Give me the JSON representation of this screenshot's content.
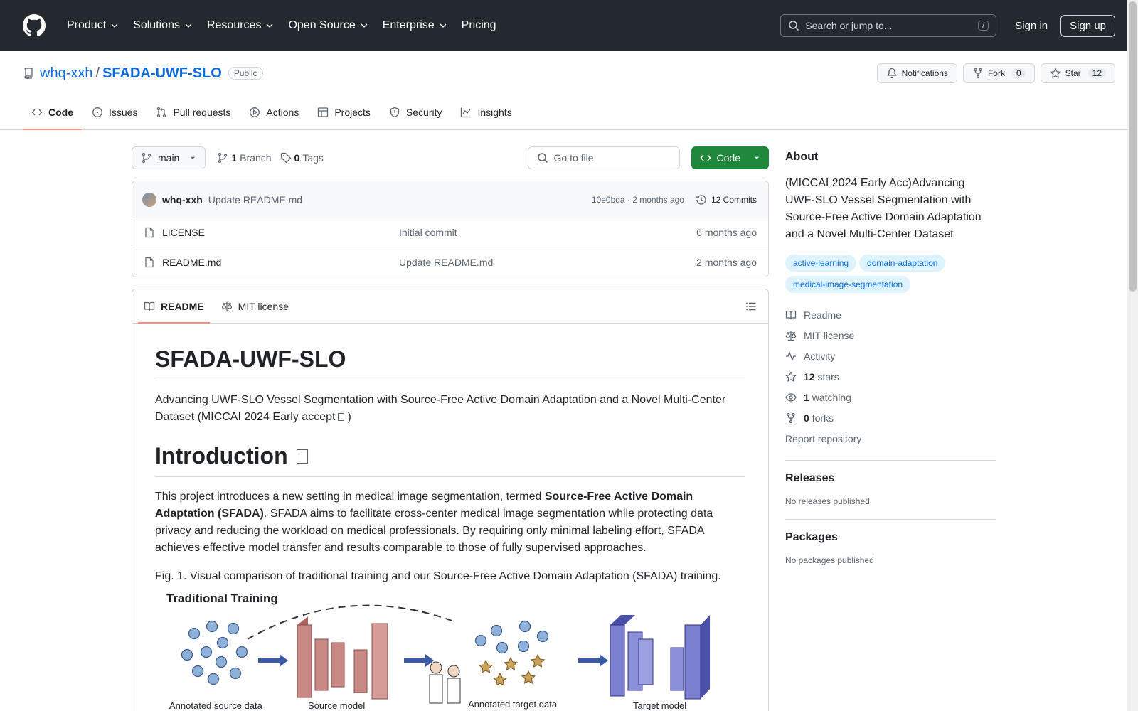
{
  "header": {
    "nav": [
      "Product",
      "Solutions",
      "Resources",
      "Open Source",
      "Enterprise",
      "Pricing"
    ],
    "search_placeholder": "Search or jump to...",
    "search_key": "/",
    "sign_in": "Sign in",
    "sign_up": "Sign up"
  },
  "repo": {
    "owner": "whq-xxh",
    "slash": "/",
    "name": "SFADA-UWF-SLO",
    "visibility": "Public",
    "notifications_label": "Notifications",
    "fork_label": "Fork",
    "fork_count": "0",
    "star_label": "Star",
    "star_count": "12"
  },
  "tabs": [
    "Code",
    "Issues",
    "Pull requests",
    "Actions",
    "Projects",
    "Security",
    "Insights"
  ],
  "filenav": {
    "branch": "main",
    "branch_count": "1",
    "branch_label": "Branch",
    "tag_count": "0",
    "tag_label": "Tags",
    "goto_placeholder": "Go to file",
    "code_label": "Code"
  },
  "commit": {
    "author": "whq-xxh",
    "message": "Update README.md",
    "meta": "10e0bda · 2 months ago",
    "count": "12 Commits"
  },
  "files": [
    {
      "name": "LICENSE",
      "message": "Initial commit",
      "time": "6 months ago"
    },
    {
      "name": "README.md",
      "message": "Update README.md",
      "time": "2 months ago"
    }
  ],
  "readme": {
    "tab_readme": "README",
    "tab_license": "MIT license",
    "title": "SFADA-UWF-SLO",
    "intro_line1": "Advancing UWF-SLO Vessel Segmentation with Source-Free Active Domain Adaptation and a Novel Multi-Center Dataset (MICCAI 2024 Early accept",
    "intro_line_end": ")",
    "h2": "Introduction",
    "p_start": "This project introduces a new setting in medical image segmentation, termed ",
    "p_bold": "Source-Free Active Domain Adaptation (SFADA)",
    "p_end": ". SFADA aims to facilitate cross-center medical image segmentation while protecting data privacy and reducing the workload on medical professionals. By requiring only minimal labeling effort, SFADA achieves effective model transfer and results comparable to those of fully supervised approaches.",
    "fig_caption": "Fig. 1. Visual comparison of traditional training and our Source-Free Active Domain Adaptation (SFADA) training.",
    "fig_title": "Traditional Training",
    "fig_label1": "Annotated source data",
    "fig_label2": "Source model",
    "fig_label3": "Annotated target data",
    "fig_label4": "Target model"
  },
  "about": {
    "title": "About",
    "description": "(MICCAI 2024 Early Acc)Advancing UWF-SLO Vessel Segmentation with Source-Free Active Domain Adaptation and a Novel Multi-Center Dataset",
    "topics": [
      "active-learning",
      "domain-adaptation",
      "medical-image-segmentation"
    ],
    "readme": "Readme",
    "license": "MIT license",
    "activity": "Activity",
    "stars_count": "12",
    "stars_label": "stars",
    "watching_count": "1",
    "watching_label": "watching",
    "forks_count": "0",
    "forks_label": "forks",
    "report": "Report repository"
  },
  "releases": {
    "title": "Releases",
    "empty": "No releases published"
  },
  "packages": {
    "title": "Packages",
    "empty": "No packages published"
  }
}
